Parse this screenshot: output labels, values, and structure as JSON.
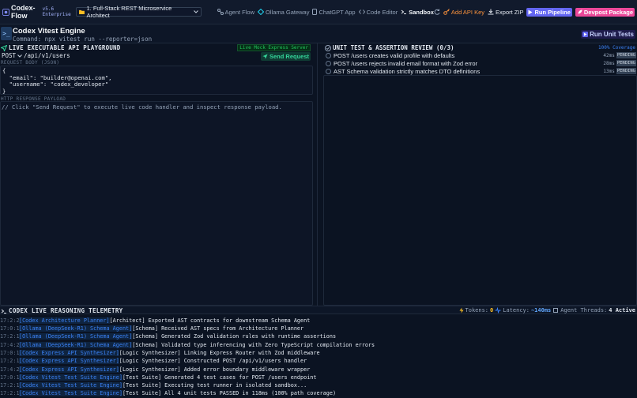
{
  "topbar": {
    "brand": "Codex-Flow",
    "version": "v5.6 Enterprise",
    "project": "1. Full-Stack REST Microservice Architect",
    "nav": [
      {
        "label": "Agent Flow",
        "icon": "agent-flow-icon"
      },
      {
        "label": "Ollama Gateway",
        "icon": "gateway-icon"
      },
      {
        "label": "ChatGPT App",
        "icon": "phone-icon"
      },
      {
        "label": "Code Editor",
        "icon": "code-icon"
      },
      {
        "label": "Sandbox",
        "icon": "terminal-icon"
      }
    ],
    "add_api_key": "Add API Key",
    "export_zip": "Export ZIP",
    "run_pipeline": "Run Pipeline",
    "devpost_package": "Devpost Package",
    "colors": {
      "accent": "#6366f1",
      "key": "#fb923c",
      "pkg": "#ec4899"
    }
  },
  "engine": {
    "icon": ">_",
    "title": "Codex Vitest Engine",
    "command": "Command: npx vitest run --reporter=json",
    "run_tests": "Run Unit Tests"
  },
  "playground": {
    "title": "LIVE EXECUTABLE API PLAYGROUND",
    "mock_tag": "Live Mock Express Server",
    "method": "POST",
    "path": "/api/v1/users",
    "send": "Send Request",
    "request_label": "REQUEST BODY (JSON)",
    "request_body": "{\n  \"email\": \"builder@openai.com\",\n  \"username\": \"codex_developer\"\n}",
    "response_label": "HTTP RESPONSE PAYLOAD",
    "response_placeholder": "// Click \"Send Request\" to execute live code handler and inspect response payload."
  },
  "review": {
    "title": "UNIT TEST & ASSERTION REVIEW (0/3)",
    "coverage": "100% Coverage",
    "tests": [
      {
        "name": "POST /users creates valid profile with defaults",
        "ms": "42ms",
        "status": "PENDING"
      },
      {
        "name": "POST /users rejects invalid email format with Zod error",
        "ms": "28ms",
        "status": "PENDING"
      },
      {
        "name": "AST Schema validation strictly matches DTO definitions",
        "ms": "13ms",
        "status": "PENDING"
      }
    ]
  },
  "telemetry": {
    "title": "CODEX LIVE REASONING TELEMETRY",
    "tokens_label": "Tokens:",
    "tokens_value": "0",
    "latency_label": "Latency:",
    "latency_value": "~140ms",
    "threads_label": "Agent Threads:",
    "threads_value": "4 Active",
    "logs": [
      {
        "time": "17:2:20",
        "source": "[Codex Architecture Planner]",
        "msg": "[Architect] Exported AST contracts for downstream Schema Agent"
      },
      {
        "time": "17:0:10",
        "source": "[Ollama (DeepSeek-R1) Schema Agent]",
        "msg": "[Schema] Received AST specs from Architecture Planner"
      },
      {
        "time": "17:2:15",
        "source": "[Ollama (DeepSeek-R1) Schema Agent]",
        "msg": "[Schema] Generated Zod validation rules with runtime assertions"
      },
      {
        "time": "17:4:20",
        "source": "[Ollama (DeepSeek-R1) Schema Agent]",
        "msg": "[Schema] Validated type inferencing with Zero TypeScript compilation errors"
      },
      {
        "time": "17:0:10",
        "source": "[Codex Express API Synthesizer]",
        "msg": "[Logic Synthesizer] Linking Express Router with Zod middleware"
      },
      {
        "time": "17:2:15",
        "source": "[Codex Express API Synthesizer]",
        "msg": "[Logic Synthesizer] Constructed POST /api/v1/users handler"
      },
      {
        "time": "17:4:20",
        "source": "[Codex Express API Synthesizer]",
        "msg": "[Logic Synthesizer] Added error boundary middleware wrapper"
      },
      {
        "time": "17:0:10",
        "source": "[Codex Vitest Test Suite Engine]",
        "msg": "[Test Suite] Generated 4 test cases for POST /users endpoint"
      },
      {
        "time": "17:2:15",
        "source": "[Codex Vitest Test Suite Engine]",
        "msg": "[Test Suite] Executing test runner in isolated sandbox..."
      },
      {
        "time": "17:2:15",
        "source": "[Codex Vitest Test Suite Engine]",
        "msg": "[Test Suite] All 4 unit tests PASSED in 118ms (100% path coverage)"
      }
    ]
  }
}
